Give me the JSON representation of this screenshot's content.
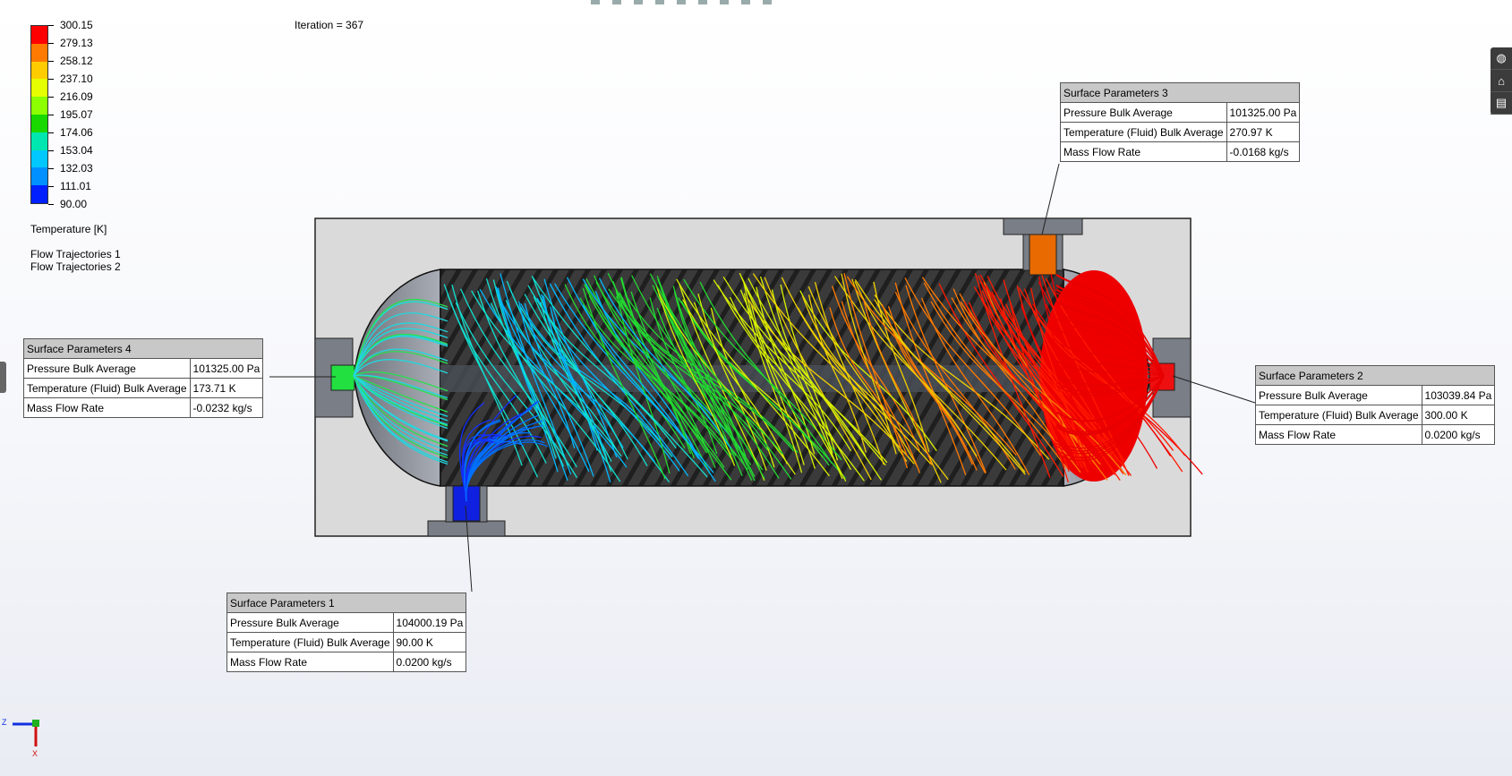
{
  "iteration": "Iteration = 367",
  "legend": {
    "values": [
      "300.15",
      "279.13",
      "258.12",
      "237.10",
      "216.09",
      "195.07",
      "174.06",
      "153.04",
      "132.03",
      "111.01",
      "90.00"
    ],
    "colors": [
      "#ff0000",
      "#ff7a00",
      "#ffcc00",
      "#e6ff00",
      "#8cff00",
      "#18d800",
      "#00e6b0",
      "#00c8ff",
      "#0090ff",
      "#0020ff"
    ],
    "title": "Temperature [K]"
  },
  "trajectories": [
    "Flow Trajectories 1",
    "Flow Trajectories 2"
  ],
  "panels": [
    {
      "title": "Surface Parameters 4",
      "rows": [
        [
          "Pressure Bulk Average",
          "101325.00 Pa"
        ],
        [
          "Temperature (Fluid) Bulk Average",
          "173.71 K"
        ],
        [
          "Mass Flow Rate",
          "-0.0232 kg/s"
        ]
      ]
    },
    {
      "title": "Surface Parameters 3",
      "rows": [
        [
          "Pressure Bulk Average",
          "101325.00 Pa"
        ],
        [
          "Temperature (Fluid) Bulk Average",
          "270.97 K"
        ],
        [
          "Mass Flow Rate",
          "-0.0168 kg/s"
        ]
      ]
    },
    {
      "title": "Surface Parameters 2",
      "rows": [
        [
          "Pressure Bulk Average",
          "103039.84 Pa"
        ],
        [
          "Temperature (Fluid) Bulk Average",
          "300.00 K"
        ],
        [
          "Mass Flow Rate",
          "0.0200 kg/s"
        ]
      ]
    },
    {
      "title": "Surface Parameters 1",
      "rows": [
        [
          "Pressure Bulk Average",
          "104000.19 Pa"
        ],
        [
          "Temperature (Fluid) Bulk Average",
          "90.00 K"
        ],
        [
          "Mass Flow Rate",
          "0.0200 kg/s"
        ]
      ]
    }
  ],
  "triad": {
    "z": "Z",
    "x": "X"
  },
  "side_icons": [
    "globe-icon",
    "home-icon",
    "layers-icon"
  ]
}
